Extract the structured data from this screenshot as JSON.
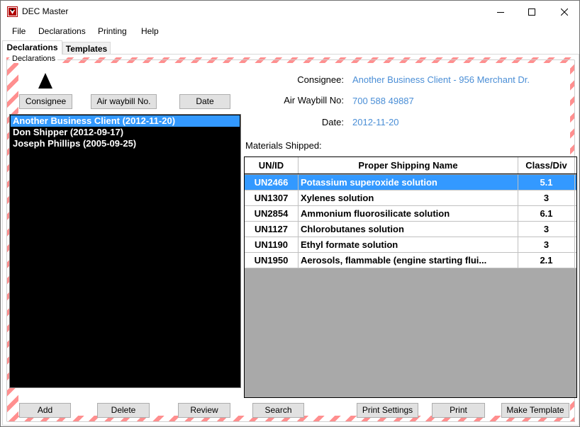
{
  "window": {
    "title": "DEC Master",
    "controls": {
      "minimize": "—",
      "maximize": "☐",
      "close": "✕"
    }
  },
  "menu": {
    "file": "File",
    "declarations": "Declarations",
    "printing": "Printing",
    "help": "Help"
  },
  "tabs": {
    "declarations": "Declarations",
    "templates": "Templates"
  },
  "group": {
    "label": "Declarations"
  },
  "sort_buttons": {
    "consignee": "Consignee",
    "air_waybill": "Air waybill No.",
    "date": "Date"
  },
  "declarations_list": [
    {
      "label": "Another Business Client (2012-11-20)",
      "selected": true
    },
    {
      "label": "Don Shipper (2012-09-17)",
      "selected": false
    },
    {
      "label": "Joseph Phillips (2005-09-25)",
      "selected": false
    }
  ],
  "details": {
    "consignee_label": "Consignee:",
    "consignee_value": "Another Business Client - 956 Merchant Dr.",
    "awb_label": "Air Waybill No:",
    "awb_value": "700 588 49887",
    "date_label": "Date:",
    "date_value": "2012-11-20",
    "materials_label": "Materials Shipped:"
  },
  "materials_table": {
    "headers": {
      "un_id": "UN/ID",
      "name": "Proper Shipping Name",
      "class_div": "Class/Div"
    },
    "rows": [
      {
        "un_id": "UN2466",
        "name": "Potassium superoxide solution",
        "class_div": "5.1",
        "selected": true
      },
      {
        "un_id": "UN1307",
        "name": "Xylenes solution",
        "class_div": "3",
        "selected": false
      },
      {
        "un_id": "UN2854",
        "name": "Ammonium fluorosilicate solution",
        "class_div": "6.1",
        "selected": false
      },
      {
        "un_id": "UN1127",
        "name": "Chlorobutanes solution",
        "class_div": "3",
        "selected": false
      },
      {
        "un_id": "UN1190",
        "name": "Ethyl formate solution",
        "class_div": "3",
        "selected": false
      },
      {
        "un_id": "UN1950",
        "name": "Aerosols, flammable  (engine starting flui...",
        "class_div": "2.1",
        "selected": false
      }
    ]
  },
  "bottom_buttons": {
    "add": "Add",
    "delete": "Delete",
    "review": "Review",
    "search": "Search",
    "print_settings": "Print Settings",
    "print": "Print",
    "make_template": "Make Template"
  },
  "colors": {
    "selection": "#3399ff",
    "value_text": "#4a8ed6",
    "stripe": "#ff8f8f",
    "list_background": "#000000",
    "grid_empty": "#a9a9a9"
  },
  "icons": [
    "app-icon",
    "minimize-icon",
    "maximize-icon",
    "close-icon",
    "sort-arrow-icon"
  ]
}
